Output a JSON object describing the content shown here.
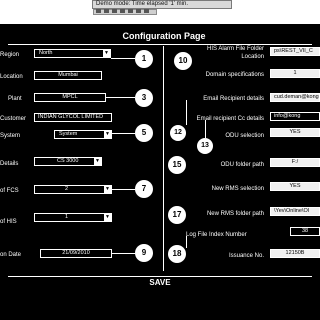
{
  "banner": {
    "text": "Demo mode: Time elapsed '1' min."
  },
  "page": {
    "title": "Configuration Page",
    "save_label": "SAVE"
  },
  "left": {
    "region_label": "Region",
    "region_value": "North",
    "location_label": "Location",
    "location_value": "Mumbai",
    "plant_label": "Plant",
    "plant_value": "MPCL",
    "customer_label": "Customer",
    "customer_value": "INDIAN GLYCOL LIMITED",
    "system_label": "System",
    "system_value": "System",
    "details_label": "Details",
    "details_value": "CS 3000",
    "fcs_label": "of FCS",
    "fcs_value": "2",
    "his_label": "of HIS",
    "his_value": "1",
    "date_label": "on Date",
    "date_value": "21/09/2010"
  },
  "right": {
    "his_alarm_label_1": "HIS Alarm File Folder",
    "his_alarm_label_2": "Location",
    "his_alarm_value": "ps\\REST_VII_C",
    "domain_label": "Domain specifications",
    "domain_value": "1",
    "email_recipient_label": "Email Recipient details",
    "email_recipient_value": "cud.deman@kong",
    "email_cc_label": "Email recipient Cc details",
    "email_cc_value": "info@kong",
    "odu_selection_label": "ODU selection",
    "odu_selection_value": "YES",
    "odu_folder_label": "ODU  folder path",
    "odu_folder_value": "F:/",
    "rms_selection_label": "New RMS selection",
    "rms_selection_value": "YES",
    "rms_folder_label": "New RMS  folder path",
    "rms_folder_value": "\\Yev\\Online\\Ol",
    "log_index_label": "Log File Index Number",
    "log_index_value": "38",
    "issuance_label": "Issuance No.",
    "issuance_value": "12150B"
  },
  "callouts": {
    "c1": "1",
    "c3": "3",
    "c5": "5",
    "c7": "7",
    "c9": "9",
    "c10": "10",
    "c12": "12",
    "c13": "13",
    "c15": "15",
    "c17": "17",
    "c18": "18"
  },
  "colors": {
    "background": "#000000",
    "foreground": "#ffffff",
    "page": "#ffffff"
  }
}
